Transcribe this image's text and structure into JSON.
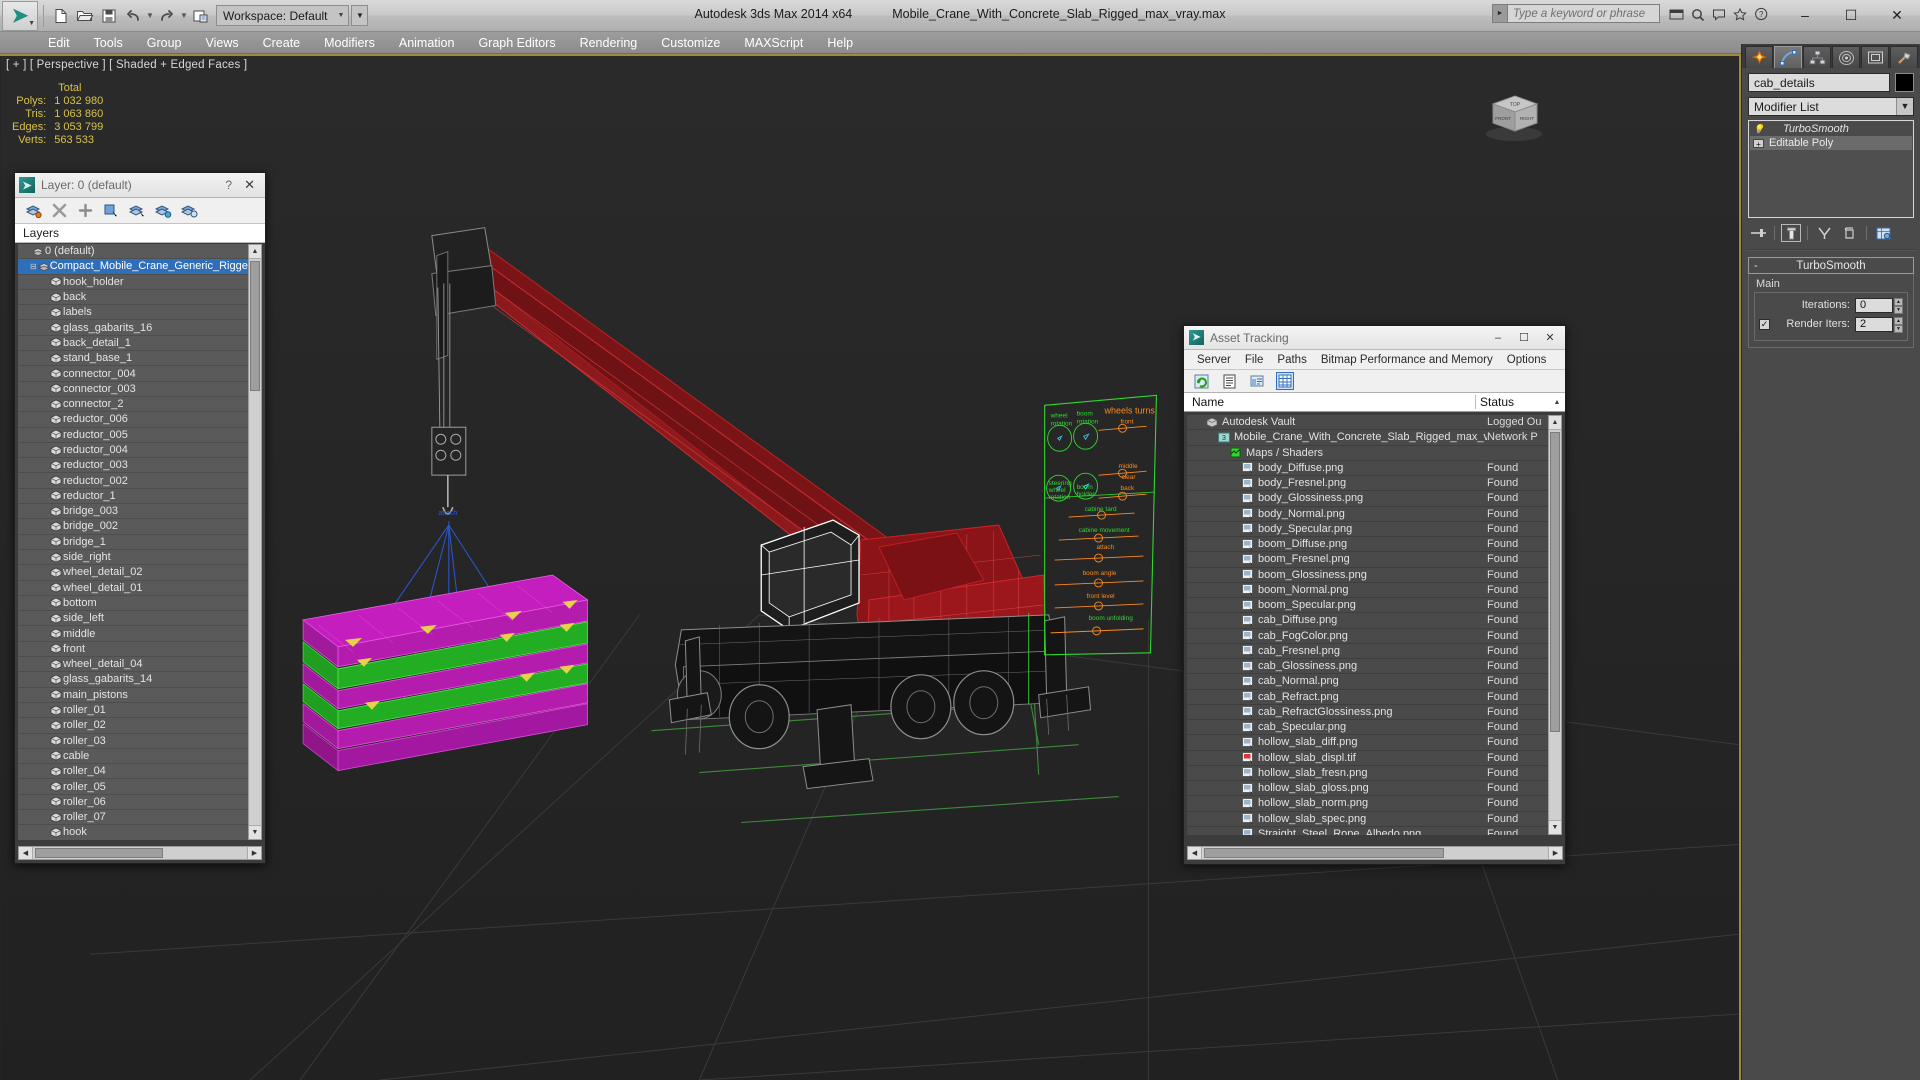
{
  "titlebar": {
    "workspace": "Workspace: Default",
    "app_title": "Autodesk 3ds Max  2014 x64",
    "file_title": "Mobile_Crane_With_Concrete_Slab_Rigged_max_vray.max",
    "search_placeholder": "Type a keyword or phrase",
    "minimize": "–",
    "maximize": "☐",
    "close": "✕",
    "logo_glyph": "➤"
  },
  "menubar": {
    "items": [
      "Edit",
      "Tools",
      "Group",
      "Views",
      "Create",
      "Modifiers",
      "Animation",
      "Graph Editors",
      "Rendering",
      "Customize",
      "MAXScript",
      "Help"
    ]
  },
  "viewport": {
    "label": "[ + ] [ Perspective ] [ Shaded + Edged Faces ]",
    "stats_header": "Total",
    "stats": [
      {
        "label": "Polys:",
        "value": "1 032 980"
      },
      {
        "label": "Tris:",
        "value": "1 063 860"
      },
      {
        "label": "Edges:",
        "value": "3 053 799"
      },
      {
        "label": "Verts:",
        "value": "563 533"
      }
    ],
    "viewcube_faces": [
      "TOP",
      "FRONT",
      "RIGHT"
    ],
    "hud_panel": {
      "title": "wheels turns",
      "green_labels": [
        "wheel rotation",
        "boom rotation",
        "steering wheel rotation",
        "boom holder",
        "cabin movement",
        "boom unfolding"
      ],
      "orange_labels": [
        "front",
        "middle",
        "back",
        "clear",
        "attach",
        "boom angle",
        "front level"
      ]
    }
  },
  "layer_dialog": {
    "title": "Layer: 0 (default)",
    "help": "?",
    "close": "✕",
    "column_header": "Layers",
    "toolbar_icons": [
      "new-layer-icon",
      "delete-layer-icon",
      "add-layer-icon",
      "select-objects-icon",
      "select-highlighted-icon",
      "highlight-selected-icon",
      "layer-properties-icon"
    ],
    "rows": [
      {
        "name": "0 (default)",
        "type": "layer",
        "selected": false,
        "indent": "root"
      },
      {
        "name": "Compact_Mobile_Crane_Generic_Rigged",
        "type": "layer",
        "selected": true,
        "indent": "root",
        "expander": "⊟"
      },
      {
        "name": "hook_holder",
        "type": "object",
        "indent": "child"
      },
      {
        "name": "back",
        "type": "object",
        "indent": "child"
      },
      {
        "name": "labels",
        "type": "object",
        "indent": "child"
      },
      {
        "name": "glass_gabarits_16",
        "type": "object",
        "indent": "child"
      },
      {
        "name": "back_detail_1",
        "type": "object",
        "indent": "child"
      },
      {
        "name": "stand_base_1",
        "type": "object",
        "indent": "child"
      },
      {
        "name": "connector_004",
        "type": "object",
        "indent": "child"
      },
      {
        "name": "connector_003",
        "type": "object",
        "indent": "child"
      },
      {
        "name": "connector_2",
        "type": "object",
        "indent": "child"
      },
      {
        "name": "reductor_006",
        "type": "object",
        "indent": "child"
      },
      {
        "name": "reductor_005",
        "type": "object",
        "indent": "child"
      },
      {
        "name": "reductor_004",
        "type": "object",
        "indent": "child"
      },
      {
        "name": "reductor_003",
        "type": "object",
        "indent": "child"
      },
      {
        "name": "reductor_002",
        "type": "object",
        "indent": "child"
      },
      {
        "name": "reductor_1",
        "type": "object",
        "indent": "child"
      },
      {
        "name": "bridge_003",
        "type": "object",
        "indent": "child"
      },
      {
        "name": "bridge_002",
        "type": "object",
        "indent": "child"
      },
      {
        "name": "bridge_1",
        "type": "object",
        "indent": "child"
      },
      {
        "name": "side_right",
        "type": "object",
        "indent": "child"
      },
      {
        "name": "wheel_detail_02",
        "type": "object",
        "indent": "child"
      },
      {
        "name": "wheel_detail_01",
        "type": "object",
        "indent": "child"
      },
      {
        "name": "bottom",
        "type": "object",
        "indent": "child"
      },
      {
        "name": "side_left",
        "type": "object",
        "indent": "child"
      },
      {
        "name": "middle",
        "type": "object",
        "indent": "child"
      },
      {
        "name": "front",
        "type": "object",
        "indent": "child"
      },
      {
        "name": "wheel_detail_04",
        "type": "object",
        "indent": "child"
      },
      {
        "name": "glass_gabarits_14",
        "type": "object",
        "indent": "child"
      },
      {
        "name": "main_pistons",
        "type": "object",
        "indent": "child"
      },
      {
        "name": "roller_01",
        "type": "object",
        "indent": "child"
      },
      {
        "name": "roller_02",
        "type": "object",
        "indent": "child"
      },
      {
        "name": "roller_03",
        "type": "object",
        "indent": "child"
      },
      {
        "name": "cable",
        "type": "object",
        "indent": "child"
      },
      {
        "name": "roller_04",
        "type": "object",
        "indent": "child"
      },
      {
        "name": "roller_05",
        "type": "object",
        "indent": "child"
      },
      {
        "name": "roller_06",
        "type": "object",
        "indent": "child"
      },
      {
        "name": "roller_07",
        "type": "object",
        "indent": "child"
      },
      {
        "name": "hook",
        "type": "object",
        "indent": "child"
      }
    ]
  },
  "asset_tracking": {
    "title": "Asset Tracking",
    "minimize": "–",
    "maximize": "☐",
    "close": "✕",
    "menu": [
      "Server",
      "File",
      "Paths",
      "Bitmap Performance and Memory",
      "Options"
    ],
    "toolbar_icons": [
      "refresh-icon",
      "list-view-icon",
      "path-editor-icon",
      "grid-view-icon"
    ],
    "columns": {
      "name": "Name",
      "status": "Status"
    },
    "rows": [
      {
        "name": "Autodesk Vault",
        "status": "Logged Ou",
        "icon": "vault-icon",
        "indent": 1
      },
      {
        "name": "Mobile_Crane_With_Concrete_Slab_Rigged_max_vray.max",
        "status": "Network P",
        "icon": "max-file-icon",
        "indent": 2
      },
      {
        "name": "Maps / Shaders",
        "status": "",
        "icon": "maps-icon",
        "indent": 3
      },
      {
        "name": "body_Diffuse.png",
        "status": "Found",
        "icon": "bitmap-icon",
        "indent": 4
      },
      {
        "name": "body_Fresnel.png",
        "status": "Found",
        "icon": "bitmap-icon",
        "indent": 4
      },
      {
        "name": "body_Glossiness.png",
        "status": "Found",
        "icon": "bitmap-icon",
        "indent": 4
      },
      {
        "name": "body_Normal.png",
        "status": "Found",
        "icon": "bitmap-icon",
        "indent": 4
      },
      {
        "name": "body_Specular.png",
        "status": "Found",
        "icon": "bitmap-icon",
        "indent": 4
      },
      {
        "name": "boom_Diffuse.png",
        "status": "Found",
        "icon": "bitmap-icon",
        "indent": 4
      },
      {
        "name": "boom_Fresnel.png",
        "status": "Found",
        "icon": "bitmap-icon",
        "indent": 4
      },
      {
        "name": "boom_Glossiness.png",
        "status": "Found",
        "icon": "bitmap-icon",
        "indent": 4
      },
      {
        "name": "boom_Normal.png",
        "status": "Found",
        "icon": "bitmap-icon",
        "indent": 4
      },
      {
        "name": "boom_Specular.png",
        "status": "Found",
        "icon": "bitmap-icon",
        "indent": 4
      },
      {
        "name": "cab_Diffuse.png",
        "status": "Found",
        "icon": "bitmap-icon",
        "indent": 4
      },
      {
        "name": "cab_FogColor.png",
        "status": "Found",
        "icon": "bitmap-icon",
        "indent": 4
      },
      {
        "name": "cab_Fresnel.png",
        "status": "Found",
        "icon": "bitmap-icon",
        "indent": 4
      },
      {
        "name": "cab_Glossiness.png",
        "status": "Found",
        "icon": "bitmap-icon",
        "indent": 4
      },
      {
        "name": "cab_Normal.png",
        "status": "Found",
        "icon": "bitmap-icon",
        "indent": 4
      },
      {
        "name": "cab_Refract.png",
        "status": "Found",
        "icon": "bitmap-icon",
        "indent": 4
      },
      {
        "name": "cab_RefractGlossiness.png",
        "status": "Found",
        "icon": "bitmap-icon",
        "indent": 4
      },
      {
        "name": "cab_Specular.png",
        "status": "Found",
        "icon": "bitmap-icon",
        "indent": 4
      },
      {
        "name": "hollow_slab_diff.png",
        "status": "Found",
        "icon": "bitmap-icon",
        "indent": 4
      },
      {
        "name": "hollow_slab_displ.tif",
        "status": "Found",
        "icon": "tif-icon",
        "indent": 4
      },
      {
        "name": "hollow_slab_fresn.png",
        "status": "Found",
        "icon": "bitmap-icon",
        "indent": 4
      },
      {
        "name": "hollow_slab_gloss.png",
        "status": "Found",
        "icon": "bitmap-icon",
        "indent": 4
      },
      {
        "name": "hollow_slab_norm.png",
        "status": "Found",
        "icon": "bitmap-icon",
        "indent": 4
      },
      {
        "name": "hollow_slab_spec.png",
        "status": "Found",
        "icon": "bitmap-icon",
        "indent": 4
      },
      {
        "name": "Straight_Steel_Rope_Albedo.png",
        "status": "Found",
        "icon": "bitmap-icon",
        "indent": 4
      }
    ]
  },
  "command_panel": {
    "tabs": [
      "create-tab",
      "modify-tab",
      "hierarchy-tab",
      "motion-tab",
      "display-tab",
      "utilities-tab"
    ],
    "active_tab_index": 1,
    "object_name": "cab_details",
    "object_color": "#000000",
    "modifier_list_label": "Modifier List",
    "stack": [
      {
        "label": "TurboSmooth",
        "italic": true
      },
      {
        "label": "Editable Poly",
        "italic": false
      }
    ],
    "stack_buttons": [
      "pin-stack-icon",
      "show-end-result-icon",
      "make-unique-icon",
      "remove-modifier-icon",
      "configure-sets-icon"
    ],
    "rollout": {
      "title": "TurboSmooth",
      "collapse": "-",
      "group_title": "Main",
      "params": [
        {
          "label": "Iterations:",
          "value": "0",
          "type": "spinner"
        },
        {
          "label": "Render Iters:",
          "value": "2",
          "type": "spinner",
          "checkbox": true,
          "checked": true
        }
      ]
    }
  }
}
